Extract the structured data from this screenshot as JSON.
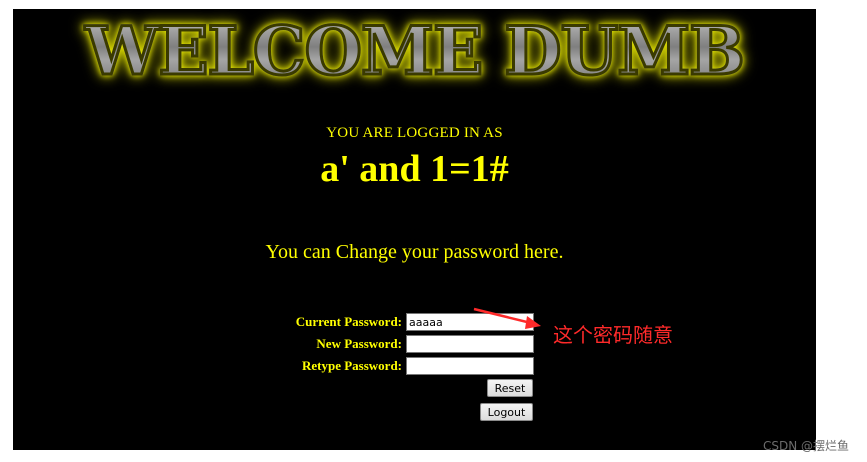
{
  "banner": {
    "title": "WELCOME DUMB"
  },
  "session": {
    "logged_in_label": "YOU ARE LOGGED IN AS",
    "username": "a' and 1=1#"
  },
  "change_password": {
    "heading": "You can Change your password here.",
    "current_label": "Current Password:",
    "current_value": "aaaaa",
    "new_label": "New Password:",
    "new_value": "",
    "retype_label": "Retype Password:",
    "retype_value": "",
    "reset_label": "Reset",
    "logout_label": "Logout"
  },
  "annotation": {
    "note": "这个密码随意",
    "color": "#ff2a2a"
  },
  "watermark": {
    "text": "CSDN @摆烂鱼"
  },
  "colors": {
    "page_bg": "#000000",
    "text": "#ffff00"
  }
}
